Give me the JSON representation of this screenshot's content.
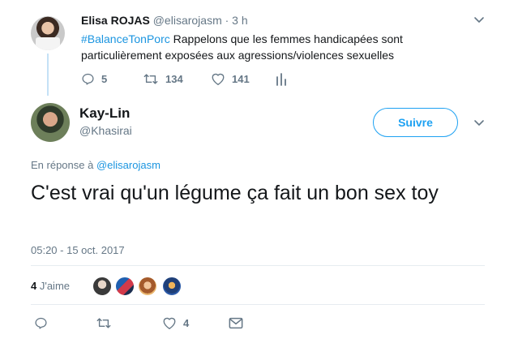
{
  "parent_tweet": {
    "name": "Elisa ROJAS",
    "handle": "@elisarojasm",
    "time": "· 3 h",
    "hashtag": "#BalanceTonPorc",
    "text_line1_rest": " Rappelons que les femmes handicapées sont",
    "text_line2": "particulièrement exposées aux agressions/violences sexuelles",
    "reply_count": "5",
    "retweet_count": "134",
    "like_count": "141",
    "icons": [
      "reply-icon",
      "retweet-icon",
      "like-icon",
      "analytics-icon",
      "chevron-down-icon"
    ]
  },
  "main_tweet": {
    "name": "Kay-Lin",
    "handle": "@Khasirai",
    "follow_label": "Suivre",
    "reply_prefix": "En réponse à ",
    "reply_mention": "@elisarojasm",
    "text": "C'est vrai qu'un légume ça fait un bon sex toy",
    "timestamp": "05:20 - 15 oct. 2017",
    "likes_count": "4",
    "likes_label": " J'aime",
    "like_count_action": "4",
    "icons": [
      "reply-icon",
      "retweet-icon",
      "like-icon",
      "message-icon",
      "chevron-down-icon"
    ]
  },
  "colors": {
    "accent": "#1da1f2",
    "link": "#1b95e0",
    "muted": "#657786",
    "thread_line": "#c4e1f6"
  }
}
